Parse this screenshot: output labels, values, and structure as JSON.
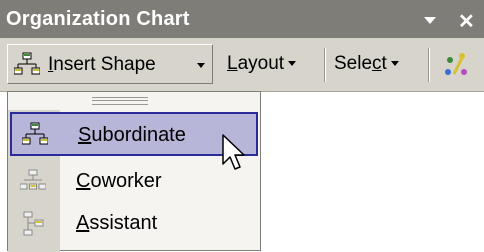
{
  "panel": {
    "title": "Organization Chart",
    "close_glyph": "✕"
  },
  "toolbar": {
    "insert_shape": {
      "accel": "I",
      "rest": "nsert Shape"
    },
    "layout": {
      "accel": "L",
      "rest": "ayout"
    },
    "select": {
      "pre": "Sele",
      "accel": "c",
      "post": "t"
    }
  },
  "menu": {
    "items": [
      {
        "accel": "S",
        "rest": "ubordinate",
        "icon": "subordinate-icon",
        "active": true
      },
      {
        "accel": "C",
        "rest": "oworker",
        "icon": "coworker-icon",
        "active": false
      },
      {
        "accel": "A",
        "rest": "ssistant",
        "icon": "assistant-icon",
        "active": false
      }
    ]
  },
  "colors": {
    "titlebar": "#7f7d78",
    "toolbar": "#d7d4cc",
    "highlight": "#b7b5d8",
    "highlight_border": "#2b2b9a"
  }
}
